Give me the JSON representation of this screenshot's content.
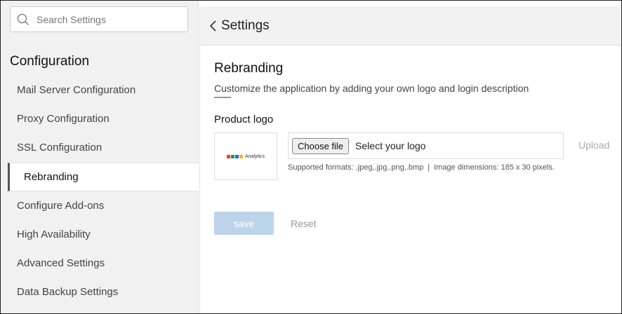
{
  "search": {
    "placeholder": "Search Settings"
  },
  "sidebar": {
    "section_title": "Configuration",
    "items": [
      {
        "label": "Mail Server Configuration"
      },
      {
        "label": "Proxy Configuration"
      },
      {
        "label": "SSL Configuration"
      },
      {
        "label": "Rebranding",
        "active": true
      },
      {
        "label": "Configure Add-ons"
      },
      {
        "label": "High Availability"
      },
      {
        "label": "Advanced Settings"
      },
      {
        "label": "Data Backup Settings"
      }
    ]
  },
  "header": {
    "back_icon": "chevron-left-icon",
    "title": "Settings"
  },
  "main": {
    "title": "Rebranding",
    "description": "Customize the application by adding your own logo and login description",
    "product_logo_label": "Product logo",
    "logo_preview_text": "Analytics",
    "choose_file_label": "Choose file",
    "file_status": "Select your logo",
    "upload_label": "Upload",
    "formats_hint": "Supported formats: .jpeg,.jpg,.png,.bmp",
    "separator": "|",
    "dimensions_hint": "Image dimensions: 185 x 30 pixels.",
    "save_label": "save",
    "reset_label": "Reset"
  },
  "colors": {
    "save_button": "#bcd4ea",
    "sidebar_bg": "#f1f1f1",
    "header_bg": "#f2f2f2"
  }
}
